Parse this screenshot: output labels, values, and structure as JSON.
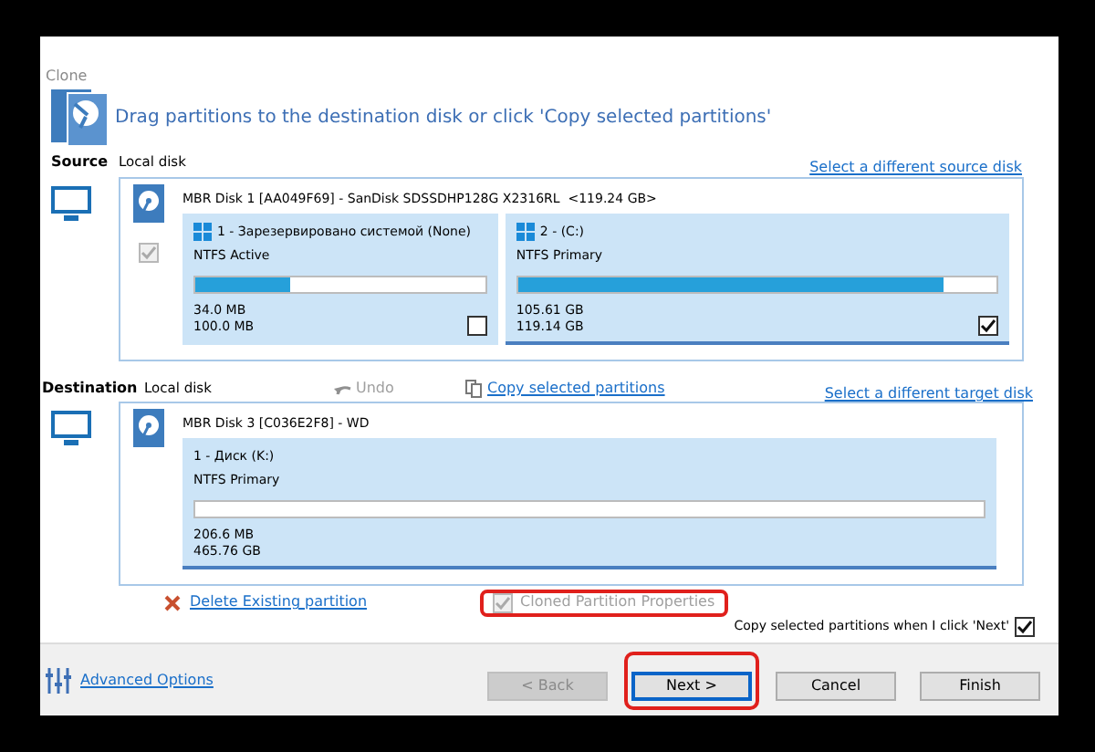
{
  "window": {
    "title": "Clone"
  },
  "instruction": "Drag partitions to the destination disk or click 'Copy selected partitions'",
  "source": {
    "label": "Source",
    "disk_type": "Local disk",
    "link": "Select a different source disk",
    "disk": {
      "title": "MBR Disk 1 [AA049F69] - SanDisk SDSSDHP128G X2316RL  <119.24 GB>",
      "checked": true,
      "disabled": true,
      "partitions": [
        {
          "name": "1 - Зарезервировано системой (None)",
          "fs": "NTFS Active",
          "level": 0.33,
          "used": "34.0 MB",
          "total": "100.0 MB",
          "checked": false,
          "selected": false,
          "os_icon": true
        },
        {
          "name": "2 -  (C:)",
          "fs": "NTFS Primary",
          "level": 0.89,
          "used": "105.61 GB",
          "total": "119.14 GB",
          "checked": true,
          "selected": true,
          "os_icon": true
        }
      ]
    }
  },
  "destination": {
    "label": "Destination",
    "disk_type": "Local disk",
    "undo": {
      "label": "Undo",
      "disabled": true
    },
    "copy_link": "Copy selected partitions",
    "link": "Select a different target disk",
    "disk": {
      "title": "MBR Disk 3 [C036E2F8] - WD",
      "partitions": [
        {
          "name": "1 - Диск (K:)",
          "fs": "NTFS Primary",
          "used": "206.6 MB",
          "total": "465.76 GB",
          "selected": true
        }
      ]
    }
  },
  "delete_link": "Delete Existing partition",
  "cloned_properties": {
    "label": "Cloned Partition Properties",
    "checked": true,
    "disabled": true,
    "highlighted": true
  },
  "copy_on_next": {
    "label": "Copy selected partitions when I click 'Next'",
    "checked": true
  },
  "advanced_link": "Advanced Options",
  "buttons": [
    {
      "label": "< Back",
      "disabled": true,
      "highlighted": false
    },
    {
      "label": "Next >",
      "disabled": false,
      "highlighted": true,
      "default": true
    },
    {
      "label": "Cancel",
      "disabled": false,
      "highlighted": false
    },
    {
      "label": "Finish",
      "disabled": false,
      "highlighted": false
    }
  ]
}
